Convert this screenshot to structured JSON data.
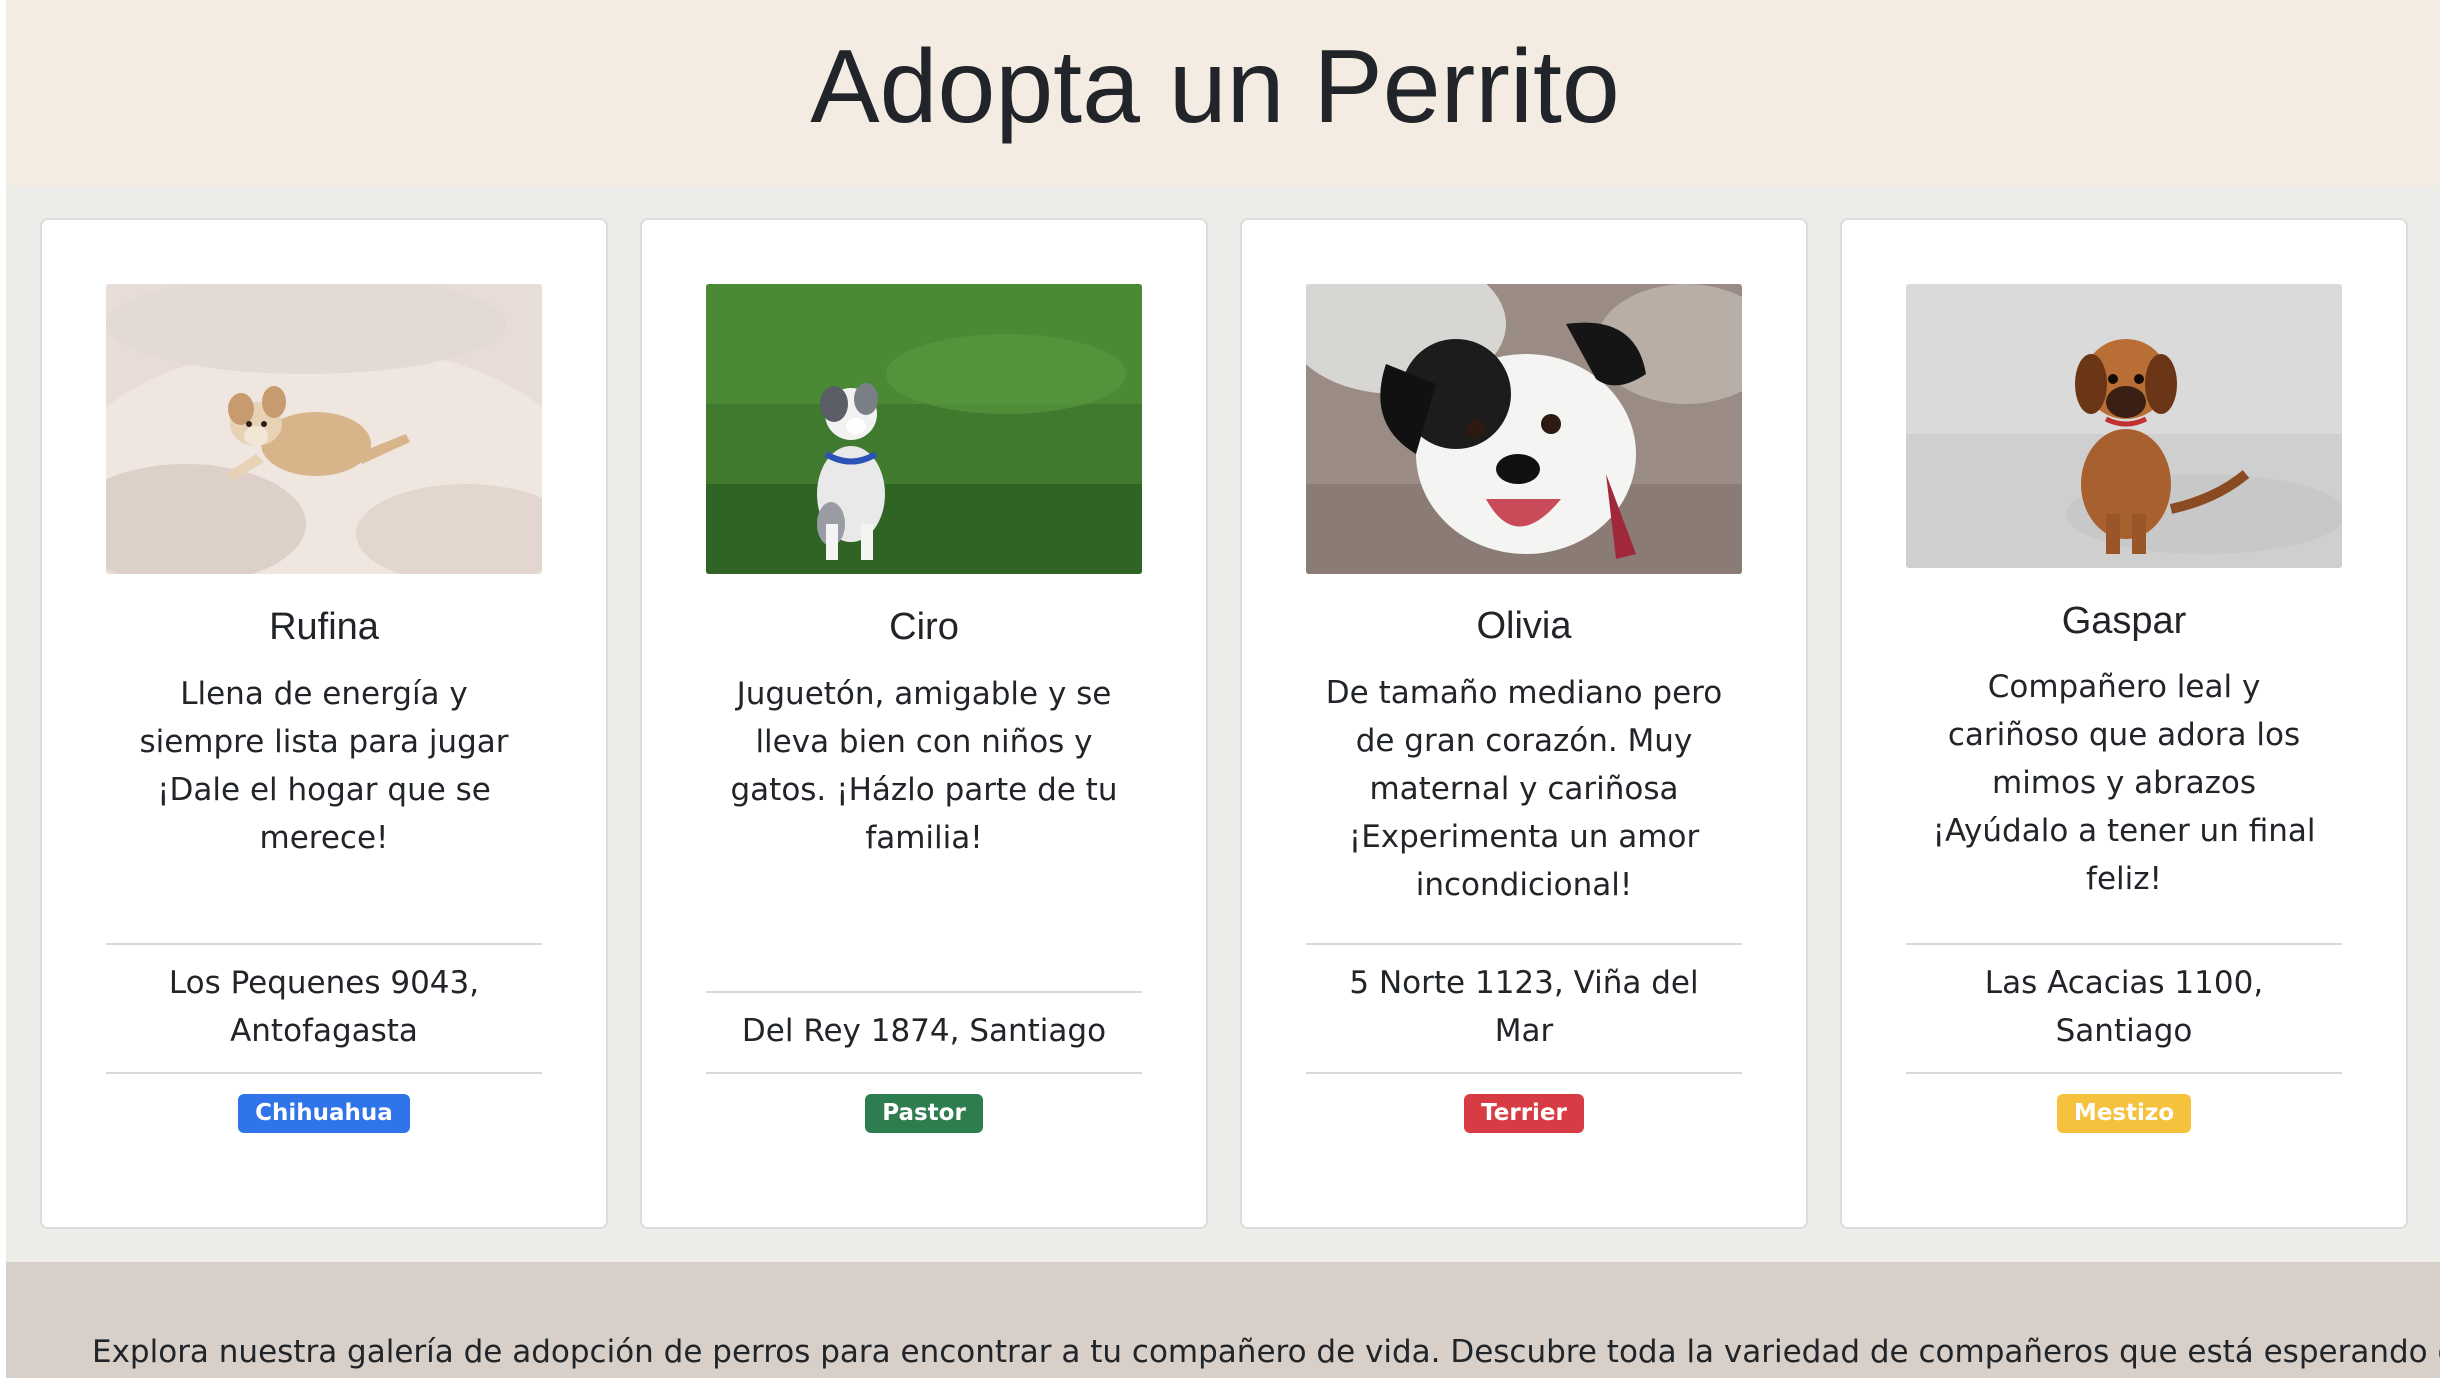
{
  "header": {
    "title": "Adopta un Perrito"
  },
  "cards": [
    {
      "name": "Rufina",
      "desc_lines": [
        "Llena de energía y",
        "siempre lista para jugar",
        "¡Dale el hogar que se",
        "merece!"
      ],
      "address_lines": [
        "Los Pequenes 9043,",
        "Antofagasta"
      ],
      "breed": "Chihuahua",
      "breed_color": "#2f74e8"
    },
    {
      "name": "Ciro",
      "desc_lines": [
        "Juguetón, amigable y se",
        "lleva bien con niños y",
        "gatos. ¡Házlo parte de tu",
        "familia!"
      ],
      "address_lines": [
        "Del Rey 1874, Santiago"
      ],
      "breed": "Pastor",
      "breed_color": "#2e7d4f"
    },
    {
      "name": "Olivia",
      "desc_lines": [
        "De tamaño mediano pero",
        "de gran corazón. Muy",
        "maternal y cariñosa",
        "¡Experimenta un amor",
        "incondicional!"
      ],
      "address_lines": [
        "5 Norte 1123, Viña del",
        "Mar"
      ],
      "breed": "Terrier",
      "breed_color": "#d73c44"
    },
    {
      "name": "Gaspar",
      "desc_lines": [
        "Compañero leal y",
        "cariñoso que adora los",
        "mimos y abrazos",
        "¡Ayúdalo a tener un final",
        "feliz!"
      ],
      "address_lines": [
        "Las Acacias 1100,",
        "Santiago"
      ],
      "breed": "Mestizo",
      "breed_color": "#f6c23e"
    }
  ],
  "footer": {
    "text": "Explora nuestra galería de adopción de perros para encontrar a tu compañero de vida. Descubre toda la variedad de compañeros que está esperando que lo"
  }
}
